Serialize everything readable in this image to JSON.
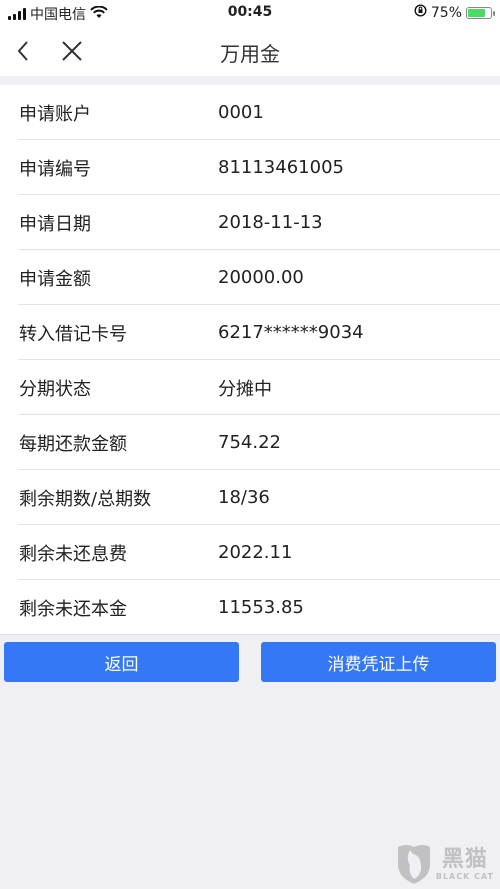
{
  "status_bar": {
    "carrier": "中国电信",
    "time": "00:45",
    "battery_percent": "75%",
    "battery_level": 0.75
  },
  "nav": {
    "title": "万用金",
    "back_icon": "chevron-left-icon",
    "close_icon": "close-icon"
  },
  "details": [
    {
      "label": "申请账户",
      "value": "0001"
    },
    {
      "label": "申请编号",
      "value": "81113461005"
    },
    {
      "label": "申请日期",
      "value": "2018-11-13"
    },
    {
      "label": "申请金额",
      "value": "20000.00"
    },
    {
      "label": "转入借记卡号",
      "value": "6217******9034"
    },
    {
      "label": "分期状态",
      "value": "分摊中"
    },
    {
      "label": "每期还款金额",
      "value": "754.22"
    },
    {
      "label": "剩余期数/总期数",
      "value": "18/36"
    },
    {
      "label": "剩余未还息费",
      "value": "2022.11"
    },
    {
      "label": "剩余未还本金",
      "value": "11553.85"
    }
  ],
  "buttons": {
    "back_label": "返回",
    "upload_label": "消费凭证上传"
  },
  "watermark": {
    "cn": "黑猫",
    "en": "BLACK CAT"
  },
  "colors": {
    "accent": "#3478f6",
    "background": "#f0eff4"
  }
}
